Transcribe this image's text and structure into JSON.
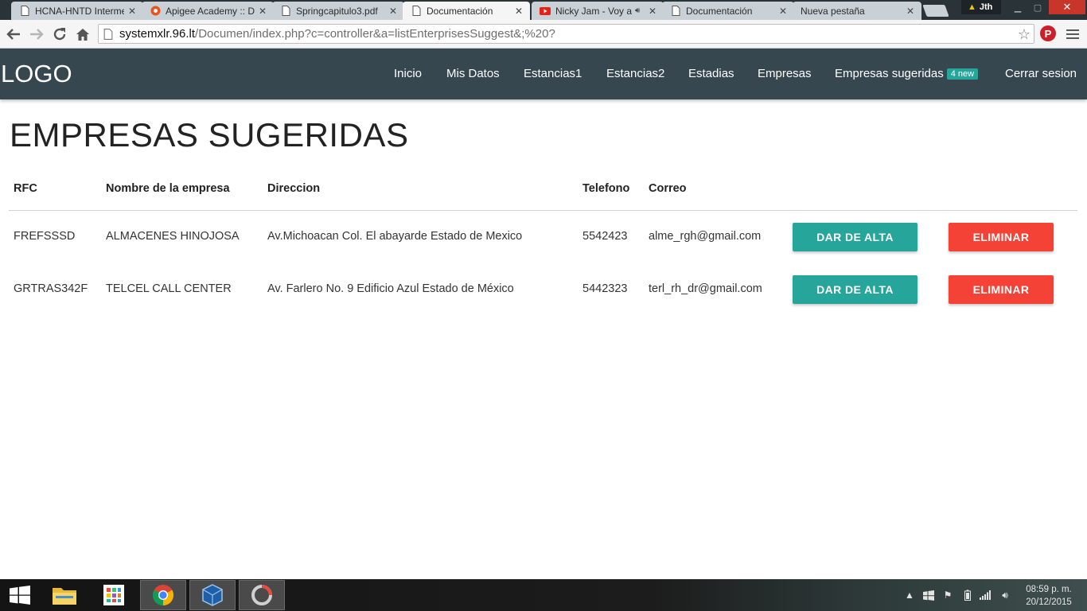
{
  "browser": {
    "tabs": [
      {
        "title": "HCNA-HNTD Interme",
        "icon": "document-icon"
      },
      {
        "title": "Apigee Academy :: D",
        "icon": "apigee-icon"
      },
      {
        "title": "Springcapitulo3.pdf",
        "icon": "document-icon"
      },
      {
        "title": "Documentación",
        "icon": "document-icon"
      },
      {
        "title": "Nicky Jam - Voy a",
        "icon": "youtube-icon"
      },
      {
        "title": "Documentación",
        "icon": "document-icon"
      },
      {
        "title": "Nueva pestaña",
        "icon": "none"
      }
    ],
    "active_tab_index": 3,
    "profile_name": "Jth",
    "url_host": "systemxlr.96.lt",
    "url_path": "/Documen/index.php?c=controller&a=listEnterprisesSuggest&;%20?"
  },
  "navbar": {
    "logo": "LOGO",
    "links": [
      "Inicio",
      "Mis Datos",
      "Estancias1",
      "Estancias2",
      "Estadias",
      "Empresas",
      "Empresas sugeridas",
      "Cerrar sesion"
    ],
    "badge": "4 new",
    "badge_color": "#26a69a",
    "background": "#37474f"
  },
  "page": {
    "title": "EMPRESAS SUGERIDAS",
    "columns": [
      "RFC",
      "Nombre de la empresa",
      "Direccion",
      "Telefono",
      "Correo"
    ],
    "rows": [
      {
        "rfc": "FREFSSSD",
        "nombre": "ALMACENES HINOJOSA",
        "direccion": "Av.Michoacan Col. El abayarde Estado de Mexico",
        "telefono": "5542423",
        "correo": "alme_rgh@gmail.com"
      },
      {
        "rfc": "GRTRAS342F",
        "nombre": "TELCEL CALL CENTER",
        "direccion": "Av. Farlero No. 9 Edificio Azul Estado de México",
        "telefono": "5442323",
        "correo": "terl_rh_dr@gmail.com"
      }
    ],
    "actions": {
      "approve": "DAR DE ALTA",
      "delete": "ELIMINAR"
    },
    "approve_color": "#26a69a",
    "delete_color": "#f44336"
  },
  "taskbar": {
    "apps": [
      "windows-start-icon",
      "file-explorer-icon",
      "store-icon",
      "chrome-icon",
      "virtualbox-icon",
      "recording-app-icon"
    ],
    "time": "08:59 p. m.",
    "date": "20/12/2015"
  }
}
